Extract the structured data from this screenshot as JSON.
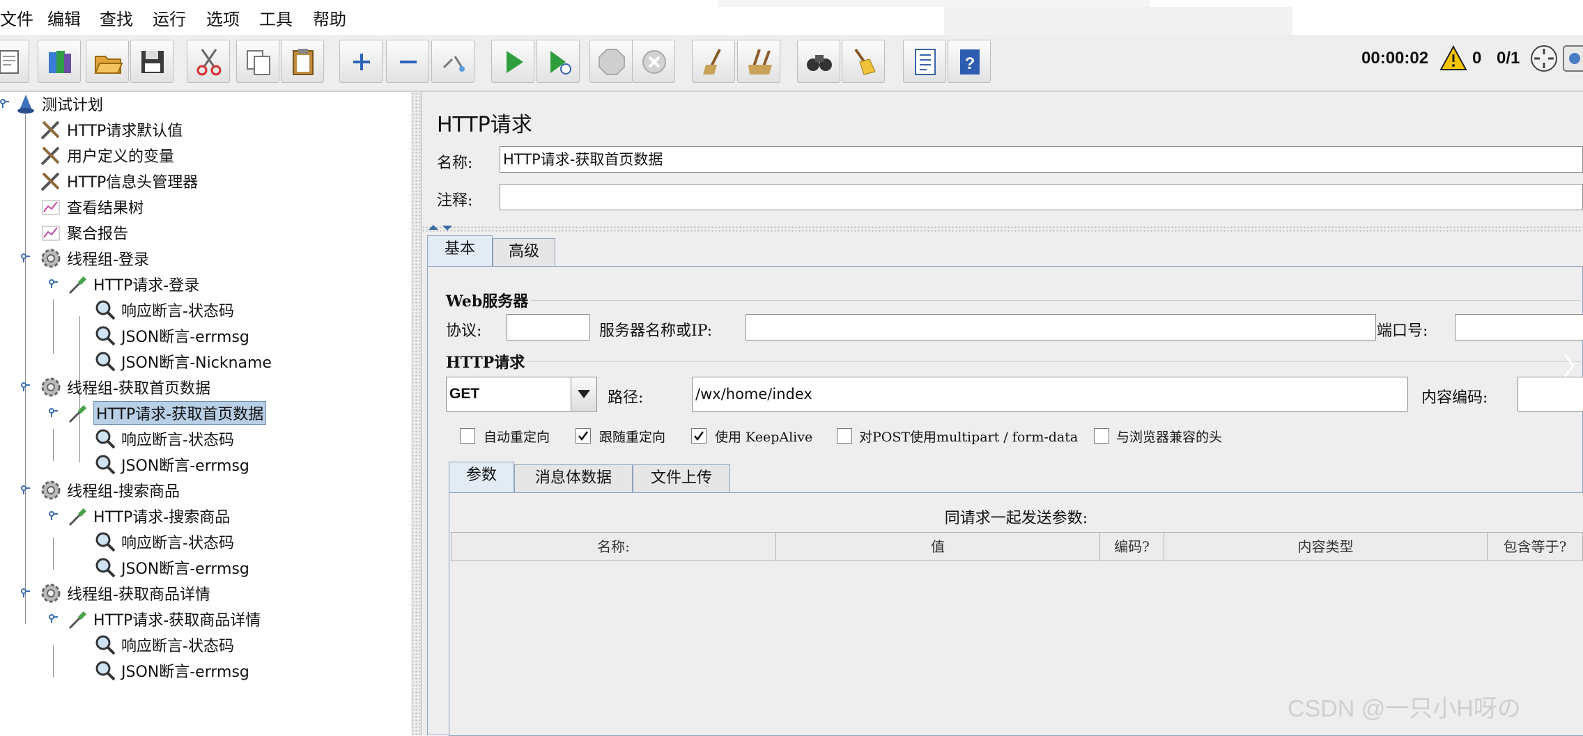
{
  "menu": [
    "文件",
    "编辑",
    "查找",
    "运行",
    "选项",
    "工具",
    "帮助"
  ],
  "toolbar": {
    "buttons": [
      "new-icon",
      "templates-icon",
      "open-icon",
      "save-icon",
      "cut-icon",
      "copy-icon",
      "paste-icon",
      "expand-icon",
      "collapse-icon",
      "toggle-icon",
      "start-icon",
      "start-no-pause-icon",
      "stop-icon",
      "shutdown-icon",
      "clear-icon",
      "clear-all-icon",
      "search-icon",
      "reset-search-icon",
      "function-helper-icon",
      "help-icon"
    ],
    "timer": "00:00:02",
    "warnings": "0",
    "threads": "0/1"
  },
  "tree": [
    {
      "label": "测试计划",
      "icon": "test-plan-icon"
    },
    {
      "label": "HTTP请求默认值",
      "icon": "config-wrench-icon"
    },
    {
      "label": "用户定义的变量",
      "icon": "config-wrench-icon"
    },
    {
      "label": "HTTP信息头管理器",
      "icon": "config-wrench-icon"
    },
    {
      "label": "查看结果树",
      "icon": "listener-chart-icon"
    },
    {
      "label": "聚合报告",
      "icon": "listener-chart-icon"
    },
    {
      "label": "线程组-登录",
      "icon": "thread-group-icon"
    },
    {
      "label": "HTTP请求-登录",
      "icon": "sampler-pipette-icon"
    },
    {
      "label": "响应断言-状态码",
      "icon": "assertion-magnifier-icon"
    },
    {
      "label": "JSON断言-errmsg",
      "icon": "assertion-magnifier-icon"
    },
    {
      "label": "JSON断言-Nickname",
      "icon": "assertion-magnifier-icon"
    },
    {
      "label": "线程组-获取首页数据",
      "icon": "thread-group-icon"
    },
    {
      "label": "HTTP请求-获取首页数据",
      "icon": "sampler-pipette-icon"
    },
    {
      "label": "响应断言-状态码",
      "icon": "assertion-magnifier-icon"
    },
    {
      "label": "JSON断言-errmsg",
      "icon": "assertion-magnifier-icon"
    },
    {
      "label": "线程组-搜索商品",
      "icon": "thread-group-icon"
    },
    {
      "label": "HTTP请求-搜索商品",
      "icon": "sampler-pipette-icon"
    },
    {
      "label": "响应断言-状态码",
      "icon": "assertion-magnifier-icon"
    },
    {
      "label": "JSON断言-errmsg",
      "icon": "assertion-magnifier-icon"
    },
    {
      "label": "线程组-获取商品详情",
      "icon": "thread-group-icon"
    },
    {
      "label": "HTTP请求-获取商品详情",
      "icon": "sampler-pipette-icon"
    },
    {
      "label": "响应断言-状态码",
      "icon": "assertion-magnifier-icon"
    },
    {
      "label": "JSON断言-errmsg",
      "icon": "assertion-magnifier-icon"
    }
  ],
  "panel": {
    "title": "HTTP请求",
    "name_label": "名称:",
    "name_value": "HTTP请求-获取首页数据",
    "comment_label": "注释:",
    "comment_value": "",
    "tabs": [
      "基本",
      "高级"
    ],
    "web_server": {
      "title": "Web服务器",
      "protocol_label": "协议:",
      "protocol_value": "",
      "server_label": "服务器名称或IP:",
      "server_value": "",
      "port_label": "端口号:",
      "port_value": ""
    },
    "http_request": {
      "title": "HTTP请求",
      "method": "GET",
      "path_label": "路径:",
      "path_value": "/wx/home/index",
      "encoding_label": "内容编码:",
      "encoding_value": ""
    },
    "checkboxes": [
      {
        "label": "自动重定向",
        "checked": false
      },
      {
        "label": "跟随重定向",
        "checked": true
      },
      {
        "label": "使用 KeepAlive",
        "checked": true
      },
      {
        "label": "对POST使用multipart / form-data",
        "checked": false
      },
      {
        "label": "与浏览器兼容的头",
        "checked": false
      }
    ],
    "sub_tabs": [
      "参数",
      "消息体数据",
      "文件上传"
    ],
    "params_caption": "同请求一起发送参数:",
    "table_headers": [
      "名称:",
      "值",
      "编码?",
      "内容类型",
      "包含等于?"
    ]
  },
  "watermark": "CSDN @一只小H呀の"
}
